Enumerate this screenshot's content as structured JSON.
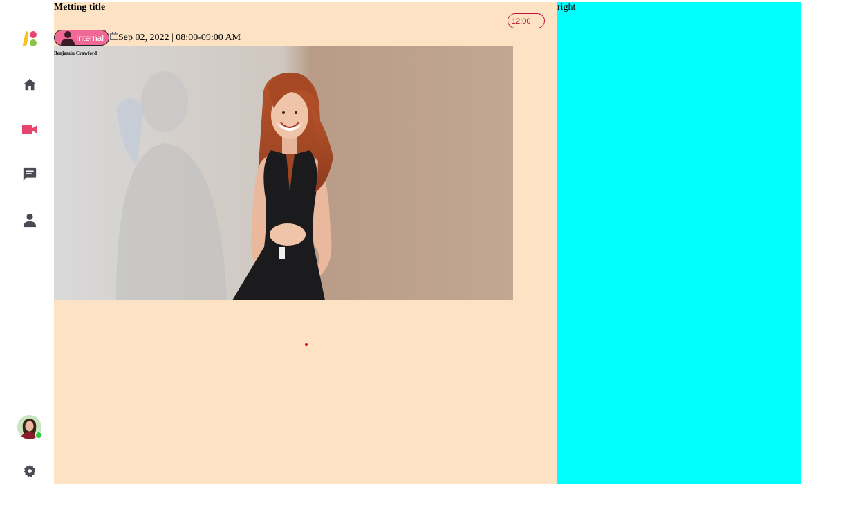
{
  "main": {
    "title": "Metting title",
    "time": "12:00",
    "tag": "Internal",
    "date_time": "Sep 02, 2022 | 08:00-09:00 AM",
    "presenter": "Benjamin Crawford"
  },
  "right": {
    "label": "right"
  },
  "sidebar": {
    "items": [
      {
        "icon": "logo-icon"
      },
      {
        "icon": "home-icon"
      },
      {
        "icon": "video-icon",
        "active": true
      },
      {
        "icon": "chat-icon"
      },
      {
        "icon": "user-icon"
      }
    ],
    "bottom": [
      {
        "icon": "avatar",
        "status": "online"
      },
      {
        "icon": "gear-icon"
      }
    ]
  },
  "colors": {
    "main_bg": "#fde3c3",
    "right_bg": "#00ffff",
    "accent": "#e8456e",
    "tag_bg": "#f06896",
    "icon": "#4a4a55"
  }
}
